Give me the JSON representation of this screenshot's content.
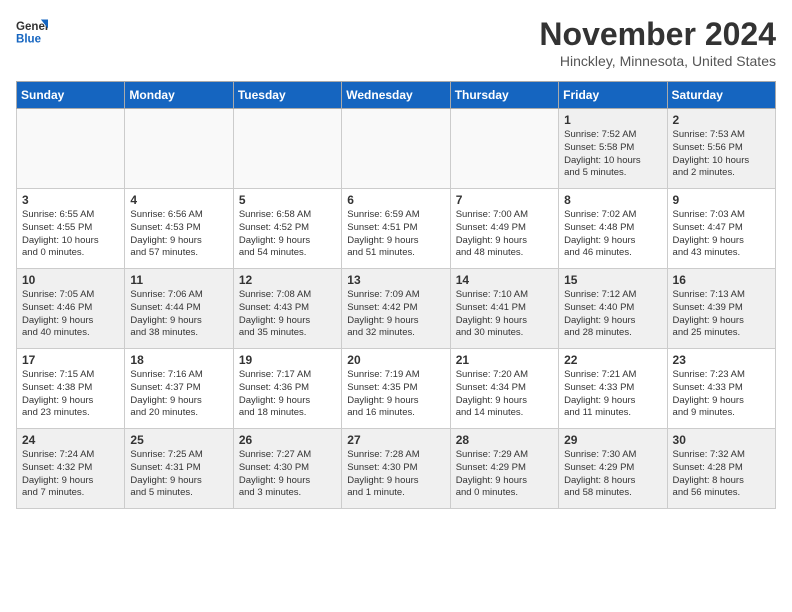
{
  "header": {
    "logo_line1": "General",
    "logo_line2": "Blue",
    "month": "November 2024",
    "location": "Hinckley, Minnesota, United States"
  },
  "days_of_week": [
    "Sunday",
    "Monday",
    "Tuesday",
    "Wednesday",
    "Thursday",
    "Friday",
    "Saturday"
  ],
  "weeks": [
    [
      {
        "day": null,
        "text": ""
      },
      {
        "day": null,
        "text": ""
      },
      {
        "day": null,
        "text": ""
      },
      {
        "day": null,
        "text": ""
      },
      {
        "day": null,
        "text": ""
      },
      {
        "day": "1",
        "text": "Sunrise: 7:52 AM\nSunset: 5:58 PM\nDaylight: 10 hours\nand 5 minutes."
      },
      {
        "day": "2",
        "text": "Sunrise: 7:53 AM\nSunset: 5:56 PM\nDaylight: 10 hours\nand 2 minutes."
      }
    ],
    [
      {
        "day": "3",
        "text": "Sunrise: 6:55 AM\nSunset: 4:55 PM\nDaylight: 10 hours\nand 0 minutes."
      },
      {
        "day": "4",
        "text": "Sunrise: 6:56 AM\nSunset: 4:53 PM\nDaylight: 9 hours\nand 57 minutes."
      },
      {
        "day": "5",
        "text": "Sunrise: 6:58 AM\nSunset: 4:52 PM\nDaylight: 9 hours\nand 54 minutes."
      },
      {
        "day": "6",
        "text": "Sunrise: 6:59 AM\nSunset: 4:51 PM\nDaylight: 9 hours\nand 51 minutes."
      },
      {
        "day": "7",
        "text": "Sunrise: 7:00 AM\nSunset: 4:49 PM\nDaylight: 9 hours\nand 48 minutes."
      },
      {
        "day": "8",
        "text": "Sunrise: 7:02 AM\nSunset: 4:48 PM\nDaylight: 9 hours\nand 46 minutes."
      },
      {
        "day": "9",
        "text": "Sunrise: 7:03 AM\nSunset: 4:47 PM\nDaylight: 9 hours\nand 43 minutes."
      }
    ],
    [
      {
        "day": "10",
        "text": "Sunrise: 7:05 AM\nSunset: 4:46 PM\nDaylight: 9 hours\nand 40 minutes."
      },
      {
        "day": "11",
        "text": "Sunrise: 7:06 AM\nSunset: 4:44 PM\nDaylight: 9 hours\nand 38 minutes."
      },
      {
        "day": "12",
        "text": "Sunrise: 7:08 AM\nSunset: 4:43 PM\nDaylight: 9 hours\nand 35 minutes."
      },
      {
        "day": "13",
        "text": "Sunrise: 7:09 AM\nSunset: 4:42 PM\nDaylight: 9 hours\nand 32 minutes."
      },
      {
        "day": "14",
        "text": "Sunrise: 7:10 AM\nSunset: 4:41 PM\nDaylight: 9 hours\nand 30 minutes."
      },
      {
        "day": "15",
        "text": "Sunrise: 7:12 AM\nSunset: 4:40 PM\nDaylight: 9 hours\nand 28 minutes."
      },
      {
        "day": "16",
        "text": "Sunrise: 7:13 AM\nSunset: 4:39 PM\nDaylight: 9 hours\nand 25 minutes."
      }
    ],
    [
      {
        "day": "17",
        "text": "Sunrise: 7:15 AM\nSunset: 4:38 PM\nDaylight: 9 hours\nand 23 minutes."
      },
      {
        "day": "18",
        "text": "Sunrise: 7:16 AM\nSunset: 4:37 PM\nDaylight: 9 hours\nand 20 minutes."
      },
      {
        "day": "19",
        "text": "Sunrise: 7:17 AM\nSunset: 4:36 PM\nDaylight: 9 hours\nand 18 minutes."
      },
      {
        "day": "20",
        "text": "Sunrise: 7:19 AM\nSunset: 4:35 PM\nDaylight: 9 hours\nand 16 minutes."
      },
      {
        "day": "21",
        "text": "Sunrise: 7:20 AM\nSunset: 4:34 PM\nDaylight: 9 hours\nand 14 minutes."
      },
      {
        "day": "22",
        "text": "Sunrise: 7:21 AM\nSunset: 4:33 PM\nDaylight: 9 hours\nand 11 minutes."
      },
      {
        "day": "23",
        "text": "Sunrise: 7:23 AM\nSunset: 4:33 PM\nDaylight: 9 hours\nand 9 minutes."
      }
    ],
    [
      {
        "day": "24",
        "text": "Sunrise: 7:24 AM\nSunset: 4:32 PM\nDaylight: 9 hours\nand 7 minutes."
      },
      {
        "day": "25",
        "text": "Sunrise: 7:25 AM\nSunset: 4:31 PM\nDaylight: 9 hours\nand 5 minutes."
      },
      {
        "day": "26",
        "text": "Sunrise: 7:27 AM\nSunset: 4:30 PM\nDaylight: 9 hours\nand 3 minutes."
      },
      {
        "day": "27",
        "text": "Sunrise: 7:28 AM\nSunset: 4:30 PM\nDaylight: 9 hours\nand 1 minute."
      },
      {
        "day": "28",
        "text": "Sunrise: 7:29 AM\nSunset: 4:29 PM\nDaylight: 9 hours\nand 0 minutes."
      },
      {
        "day": "29",
        "text": "Sunrise: 7:30 AM\nSunset: 4:29 PM\nDaylight: 8 hours\nand 58 minutes."
      },
      {
        "day": "30",
        "text": "Sunrise: 7:32 AM\nSunset: 4:28 PM\nDaylight: 8 hours\nand 56 minutes."
      }
    ]
  ]
}
